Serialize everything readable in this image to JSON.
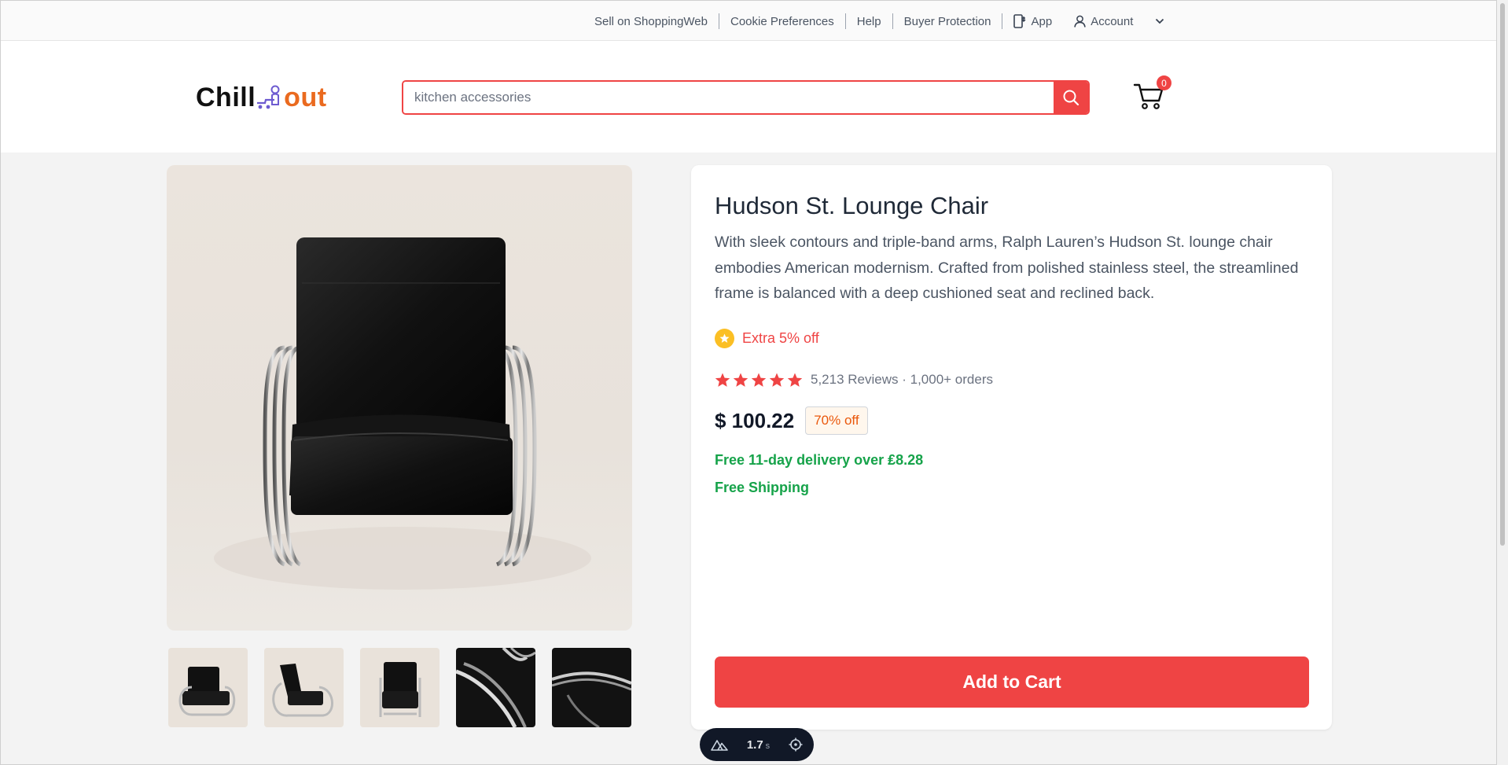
{
  "topnav": {
    "sell": "Sell on ShoppingWeb",
    "cookies": "Cookie Preferences",
    "help": "Help",
    "buyer_protection": "Buyer Protection",
    "app": "App",
    "account": "Account"
  },
  "header": {
    "logo_part1": "Chill",
    "logo_part2": "out",
    "search_placeholder": "kitchen accessories",
    "cart_count": "0"
  },
  "product": {
    "title": "Hudson St. Lounge Chair",
    "description": "With sleek contours and triple-band arms, Ralph Lauren’s Hudson St. lounge chair embodies American modernism. Crafted from polished stainless steel, the streamlined frame is balanced with a deep cushioned seat and reclined back.",
    "promo": "Extra 5% off",
    "rating_stars": 5,
    "reviews_text": "5,213 Reviews · 1,000+ orders",
    "price": "$ 100.22",
    "discount": "70% off",
    "delivery": "Free 11-day delivery over ₤8.28",
    "shipping": "Free Shipping",
    "add_to_cart": "Add to Cart"
  },
  "thumbnails": [
    {
      "style": "light",
      "name": "thumbnail-chair-angle"
    },
    {
      "style": "light",
      "name": "thumbnail-chair-side"
    },
    {
      "style": "light",
      "name": "thumbnail-chair-front"
    },
    {
      "style": "dark",
      "name": "thumbnail-arm-detail"
    },
    {
      "style": "dark",
      "name": "thumbnail-arm-closeup"
    }
  ],
  "devtools": {
    "time": "1.7",
    "unit": "s"
  },
  "colors": {
    "accent": "#ef4444",
    "logo_orange": "#ea6a1f",
    "success": "#16a34a",
    "discount": "#ea580c"
  }
}
